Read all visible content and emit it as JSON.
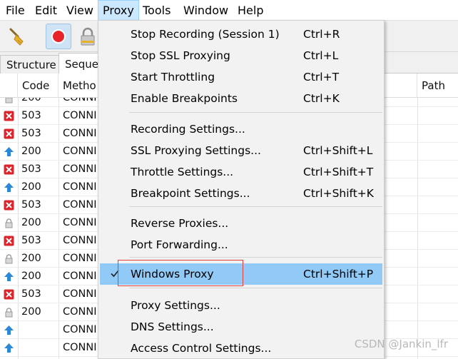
{
  "menubar": {
    "items": [
      "File",
      "Edit",
      "View",
      "Proxy",
      "Tools",
      "Window",
      "Help"
    ],
    "active": "Proxy"
  },
  "toolbar": {
    "buttons": [
      "broom-icon",
      "record-icon",
      "ssl-lock-icon"
    ]
  },
  "tabs": {
    "structure": "Structure",
    "sequence": "Seque"
  },
  "table": {
    "headers": {
      "code": "Code",
      "method": "Metho",
      "path": "Path"
    },
    "rows": [
      {
        "status": "lock",
        "code": "200",
        "method": "CONNI"
      },
      {
        "status": "error",
        "code": "503",
        "method": "CONNI"
      },
      {
        "status": "error",
        "code": "503",
        "method": "CONNI"
      },
      {
        "status": "up",
        "code": "200",
        "method": "CONNI"
      },
      {
        "status": "error",
        "code": "503",
        "method": "CONNI"
      },
      {
        "status": "up",
        "code": "200",
        "method": "CONNI"
      },
      {
        "status": "error",
        "code": "503",
        "method": "CONNI"
      },
      {
        "status": "lock",
        "code": "200",
        "method": "CONNI"
      },
      {
        "status": "error",
        "code": "503",
        "method": "CONNI"
      },
      {
        "status": "lock",
        "code": "200",
        "method": "CONNI"
      },
      {
        "status": "up",
        "code": "200",
        "method": "CONNI"
      },
      {
        "status": "error",
        "code": "503",
        "method": "CONNI"
      },
      {
        "status": "lock",
        "code": "200",
        "method": "CONNI"
      },
      {
        "status": "up",
        "code": "",
        "method": "CONNI"
      },
      {
        "status": "up",
        "code": "",
        "method": "CONNI"
      }
    ]
  },
  "proxy_menu": {
    "items": [
      {
        "label": "Stop Recording (Session 1)",
        "shortcut": "Ctrl+R"
      },
      {
        "label": "Stop SSL Proxying",
        "shortcut": "Ctrl+L"
      },
      {
        "label": "Start Throttling",
        "shortcut": "Ctrl+T"
      },
      {
        "label": "Enable Breakpoints",
        "shortcut": "Ctrl+K"
      },
      {
        "label": "Recording Settings...",
        "shortcut": ""
      },
      {
        "label": "SSL Proxying Settings...",
        "shortcut": "Ctrl+Shift+L"
      },
      {
        "label": "Throttle Settings...",
        "shortcut": "Ctrl+Shift+T"
      },
      {
        "label": "Breakpoint Settings...",
        "shortcut": "Ctrl+Shift+K"
      },
      {
        "label": "Reverse Proxies...",
        "shortcut": ""
      },
      {
        "label": "Port Forwarding...",
        "shortcut": ""
      },
      {
        "label": "Windows Proxy",
        "shortcut": "Ctrl+Shift+P",
        "checked": true,
        "highlighted": true
      },
      {
        "label": "Proxy Settings...",
        "shortcut": ""
      },
      {
        "label": "DNS Settings...",
        "shortcut": ""
      },
      {
        "label": "Access Control Settings...",
        "shortcut": ""
      }
    ]
  },
  "watermark": "CSDN @Jankin_lfr",
  "colors": {
    "highlight": "#91c9f7",
    "menu_active": "#cce8ff",
    "error_red": "#d9252c",
    "up_arrow_blue": "#2b88d8",
    "annotation_red": "#e0403a"
  }
}
